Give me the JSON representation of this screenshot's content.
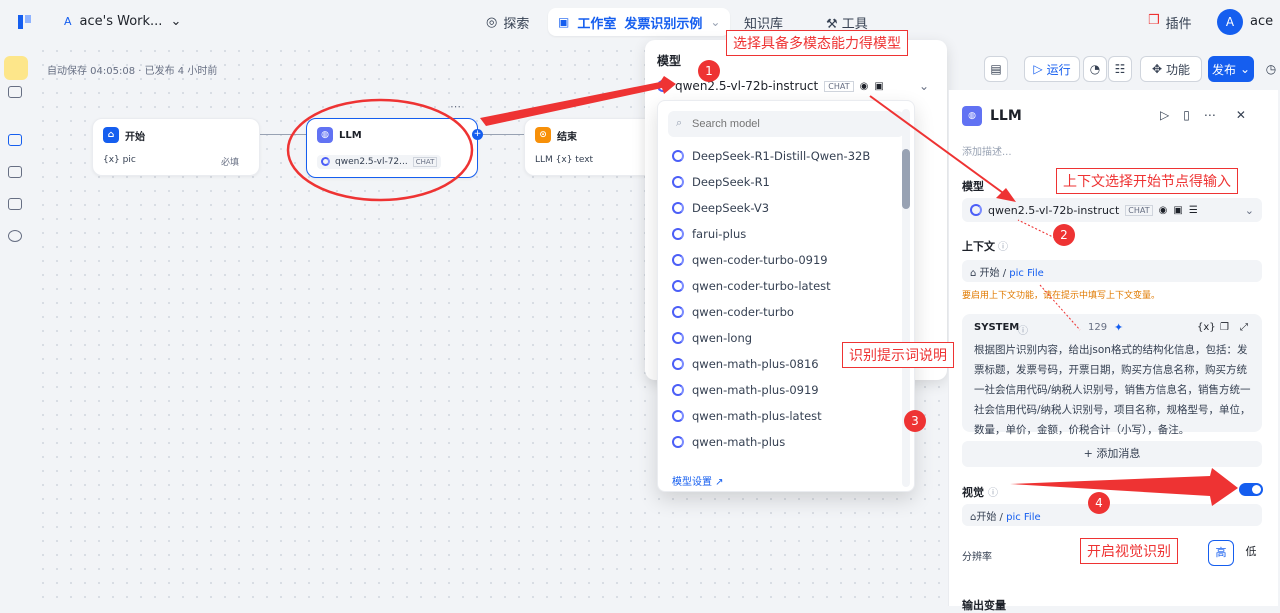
{
  "topbar": {
    "workspace_initial": "A",
    "workspace_name": "ace's Work...",
    "explore": "探索",
    "studio": "工作室",
    "app_name": "发票识别示例",
    "knowledge": "知识库",
    "tools": "工具",
    "plugins": "插件",
    "avatar_initial": "A",
    "username": "ace"
  },
  "canvas": {
    "autosave": "自动保存 04:05:08 · 已发布 4 小时前",
    "start_node": {
      "title": "开始",
      "var": "{x} pic",
      "required": "必填"
    },
    "llm_node": {
      "title": "LLM",
      "model": "qwen2.5-vl-72...",
      "tag": "CHAT"
    },
    "end_node": {
      "title": "结束",
      "var": "LLM {x} text"
    }
  },
  "model_panel": {
    "label": "模型",
    "selected_model": "qwen2.5-vl-72b-instruct",
    "selected_tag": "CHAT",
    "search_placeholder": "Search model",
    "models": [
      "DeepSeek-R1-Distill-Qwen-32B",
      "DeepSeek-R1",
      "DeepSeek-V3",
      "farui-plus",
      "qwen-coder-turbo-0919",
      "qwen-coder-turbo-latest",
      "qwen-coder-turbo",
      "qwen-long",
      "qwen-math-plus-0816",
      "qwen-math-plus-0919",
      "qwen-math-plus-latest",
      "qwen-math-plus"
    ],
    "settings_link": "模型设置 ↗"
  },
  "toolbar": {
    "run": "运行",
    "features": "功能",
    "publish": "发布"
  },
  "right_panel": {
    "title": "LLM",
    "desc_placeholder": "添加描述...",
    "model_label": "模型",
    "model_name": "qwen2.5-vl-72b-instruct",
    "model_tag": "CHAT",
    "context_label": "上下文",
    "context_chip_node": "开始",
    "context_chip_var": "pic File",
    "context_warning": "要启用上下文功能，请在提示中填写上下文变量。",
    "system_label": "SYSTEM",
    "system_count": "129",
    "system_text": "根据图片识别内容，给出json格式的结构化信息，包括：发票标题，发票号码，开票日期，购买方信息名称，购买方统一社会信用代码/纳税人识别号，销售方信息名，销售方统一社会信用代码/纳税人识别号，项目名称，规格型号，单位，数量，单价，金额，价税合计（小写），备注。",
    "add_message": "+ 添加消息",
    "vision_label": "视觉",
    "vision_chip_node": "开始",
    "vision_chip_var": "pic File",
    "resolution_label": "分辨率",
    "res_high": "高",
    "res_low": "低",
    "output_label": "输出变量"
  },
  "annotations": {
    "a1": "选择具备多模态能力得模型",
    "a2": "上下文选择开始节点得输入",
    "a3": "识别提示词说明",
    "a4": "开启视觉识别",
    "n1": "1",
    "n2": "2",
    "n3": "3",
    "n4": "4"
  },
  "colors": {
    "accent": "#155eef",
    "annotation": "#ee3333"
  }
}
